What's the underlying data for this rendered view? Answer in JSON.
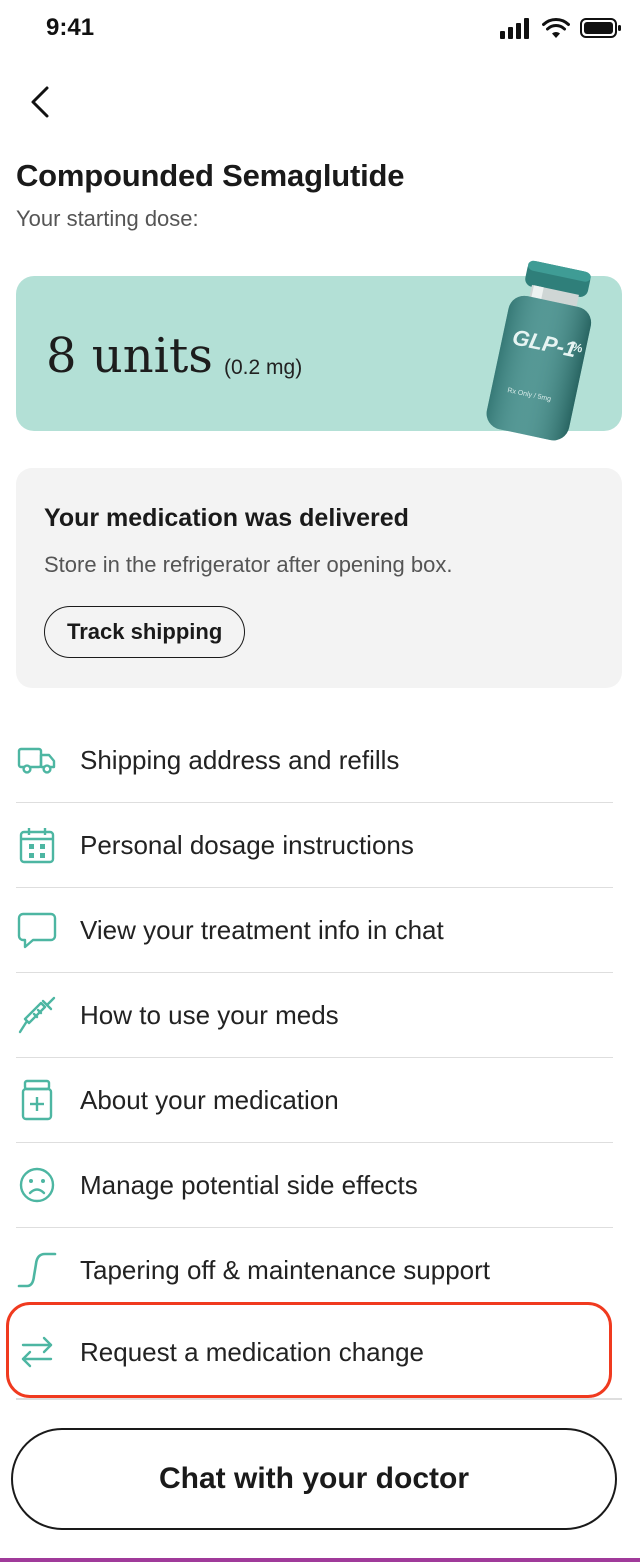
{
  "status_bar": {
    "time": "9:41"
  },
  "header": {
    "title": "Compounded Semaglutide",
    "subtitle": "Your starting dose:"
  },
  "dose_card": {
    "value": "8 units",
    "mg": "(0.2 mg)",
    "vial_label": "GLP-1",
    "vial_small": "%",
    "vial_subtext": "Rx Only / 5mg",
    "color": "#b3e0d6"
  },
  "delivery": {
    "title": "Your medication was delivered",
    "text": "Store in the refrigerator after opening box.",
    "track_label": "Track shipping"
  },
  "menu": {
    "items": [
      {
        "label": "Shipping address and refills",
        "icon": "truck-icon"
      },
      {
        "label": "Personal dosage instructions",
        "icon": "calendar-icon"
      },
      {
        "label": "View your treatment info in chat",
        "icon": "chat-bubble-icon"
      },
      {
        "label": "How to use your meds",
        "icon": "syringe-icon"
      },
      {
        "label": "About your medication",
        "icon": "pill-bottle-icon"
      },
      {
        "label": "Manage potential side effects",
        "icon": "sad-face-icon"
      },
      {
        "label": "Tapering off & maintenance support",
        "icon": "taper-curve-icon"
      },
      {
        "label": "Request a medication change",
        "icon": "swap-arrows-icon"
      }
    ]
  },
  "chat_button": {
    "label": "Chat with your doctor"
  },
  "colors": {
    "accent": "#4db6a2",
    "highlight": "#f03a1f"
  }
}
